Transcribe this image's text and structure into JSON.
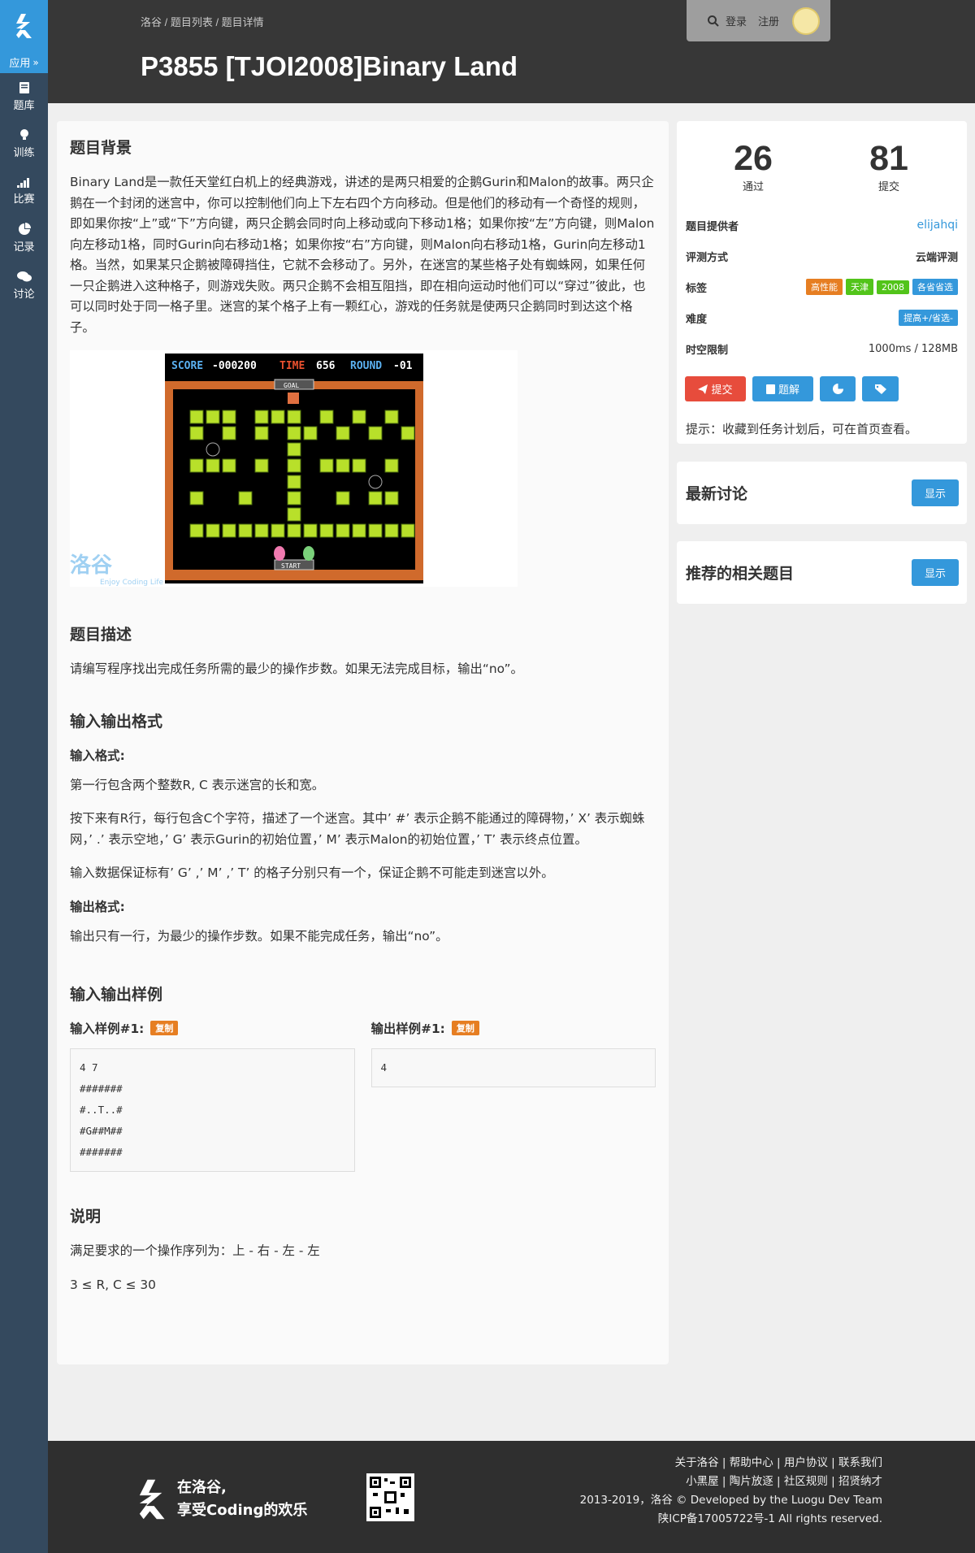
{
  "sidebar": {
    "app_label": "应用",
    "items": [
      {
        "icon": "book-icon",
        "label": "题库"
      },
      {
        "icon": "bulb-icon",
        "label": "训练"
      },
      {
        "icon": "signal-icon",
        "label": "比赛"
      },
      {
        "icon": "pie-icon",
        "label": "记录"
      },
      {
        "icon": "comments-icon",
        "label": "讨论"
      }
    ]
  },
  "header": {
    "breadcrumb": "洛谷 / 题目列表 / 题目详情",
    "title": "P3855 [TJOI2008]Binary Land",
    "login": "登录",
    "register": "注册"
  },
  "problem": {
    "background_title": "题目背景",
    "background_text": "Binary Land是一款任天堂红白机上的经典游戏，讲述的是两只相爱的企鹅Gurin和Malon的故事。两只企鹅在一个封闭的迷宫中，你可以控制他们向上下左右四个方向移动。但是他们的移动有一个奇怪的规则，即如果你按“上”或“下”方向键，两只企鹅会同时向上移动或向下移动1格；如果你按“左”方向键，则Malon向左移动1格，同时Gurin向右移动1格；如果你按“右”方向键，则Malon向右移动1格，Gurin向左移动1格。当然，如果某只企鹅被障碍挡住，它就不会移动了。另外，在迷宫的某些格子处有蜘蛛网，如果任何一只企鹅进入这种格子，则游戏失败。两只企鹅不会相互阻挡，即在相向运动时他们可以“穿过”彼此，也可以同时处于同一格子里。迷宫的某个格子上有一颗红心，游戏的任务就是使两只企鹅同时到达这个格子。",
    "game_image": {
      "score_label": "SCORE",
      "score_value": "-000200",
      "time_label": "TIME",
      "time_value": "656",
      "round_label": "ROUND",
      "round_value": "-01",
      "goal_label": "GOAL",
      "start_label": "START",
      "watermark_main": "洛谷",
      "watermark_sub": "Enjoy Coding Life"
    },
    "description_title": "题目描述",
    "description_text": "请编写程序找出完成任务所需的最少的操作步数。如果无法完成目标，输出“no”。",
    "io_title": "输入输出格式",
    "input_format_title": "输入格式:",
    "input_format_p1": "第一行包含两个整数R, C 表示迷宫的长和宽。",
    "input_format_p2": "按下来有R行，每行包含C个字符，描述了一个迷宫。其中’ #’ 表示企鹅不能通过的障碍物，’ X’ 表示蜘蛛网，’ .’ 表示空地，’ G’ 表示Gurin的初始位置，’ M’ 表示Malon的初始位置，’ T’ 表示终点位置。",
    "input_format_p3": "输入数据保证标有’ G’ ,’ M’ ,’ T’ 的格子分别只有一个，保证企鹅不可能走到迷宫以外。",
    "output_format_title": "输出格式:",
    "output_format_text": "输出只有一行，为最少的操作步数。如果不能完成任务，输出“no”。",
    "samples_title": "输入输出样例",
    "sample_input_label": "输入样例#1:",
    "sample_output_label": "输出样例#1:",
    "copy_label": "复制",
    "sample_input": "4 7\n#######\n#..T..#\n#G##M##\n#######",
    "sample_output": "4",
    "notes_title": "说明",
    "notes_p1": "满足要求的一个操作序列为：上 - 右 - 左 - 左",
    "notes_p2": "3 ≤ R, C ≤ 30"
  },
  "info": {
    "accepted": "26",
    "accepted_label": "通过",
    "submitted": "81",
    "submitted_label": "提交",
    "provider_label": "题目提供者",
    "provider": "elijahqi",
    "judge_label": "评测方式",
    "judge": "云端评测",
    "tags_label": "标签",
    "tags": [
      {
        "text": "高性能",
        "color": "#e67e22"
      },
      {
        "text": "天津",
        "color": "#52c41a"
      },
      {
        "text": "2008",
        "color": "#52c41a"
      },
      {
        "text": "各省省选",
        "color": "#3498db"
      }
    ],
    "difficulty_label": "难度",
    "difficulty": "提高+/省选-",
    "difficulty_color": "#3498db",
    "limit_label": "时空限制",
    "limit": "1000ms / 128MB",
    "submit_btn": "提交",
    "solution_btn": "题解",
    "hint": "提示：收藏到任务计划后，可在首页查看。"
  },
  "discussions": {
    "title": "最新讨论",
    "button": "显示"
  },
  "related": {
    "title": "推荐的相关题目",
    "button": "显示"
  },
  "footer": {
    "slogan_line1": "在洛谷,",
    "slogan_line2": "享受Coding的欢乐",
    "links_row1": "关于洛谷 | 帮助中心 | 用户协议 | 联系我们",
    "links_row2": "小黑屋 | 陶片放逐 | 社区规则 | 招贤纳才",
    "copyright": "2013-2019，洛谷 © Developed by the Luogu Dev Team",
    "icp": "陕ICP备17005722号-1 All rights reserved."
  },
  "colors": {
    "sidebar": "#34495e",
    "accent": "#3498db",
    "header": "#373737",
    "danger": "#e74c3c"
  }
}
